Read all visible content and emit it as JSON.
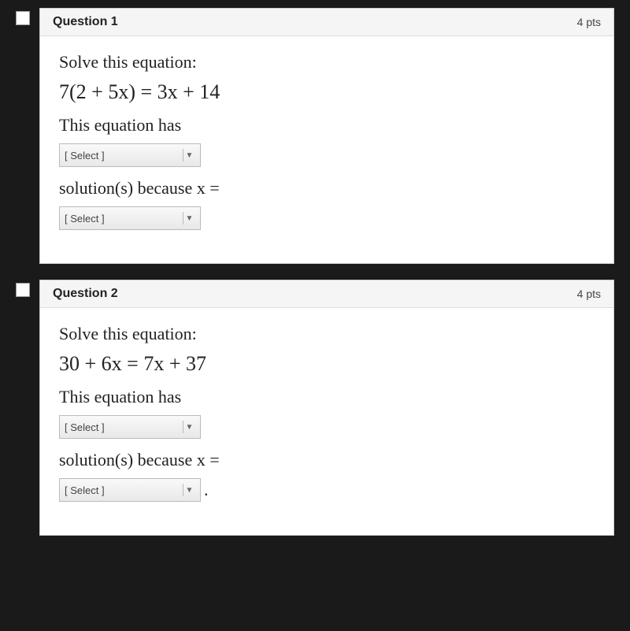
{
  "questions": [
    {
      "id": "q1",
      "title": "Question 1",
      "points": "4 pts",
      "prompt": "Solve this equation:",
      "equation": "7(2 + 5x) = 3x + 14",
      "text_before_dropdown": "This equation has",
      "dropdown1": {
        "placeholder": "[ Select ]"
      },
      "text_after_dropdown": "solution(s) because x =",
      "dropdown2": {
        "placeholder": "[ Select ]"
      },
      "trailing_punctuation": ""
    },
    {
      "id": "q2",
      "title": "Question 2",
      "points": "4 pts",
      "prompt": "Solve this equation:",
      "equation": "30 + 6x = 7x + 37",
      "text_before_dropdown": "This equation has",
      "dropdown1": {
        "placeholder": "[ Select ]"
      },
      "text_after_dropdown": "solution(s) because x =",
      "dropdown2": {
        "placeholder": "[ Select ]"
      },
      "trailing_punctuation": "."
    }
  ]
}
